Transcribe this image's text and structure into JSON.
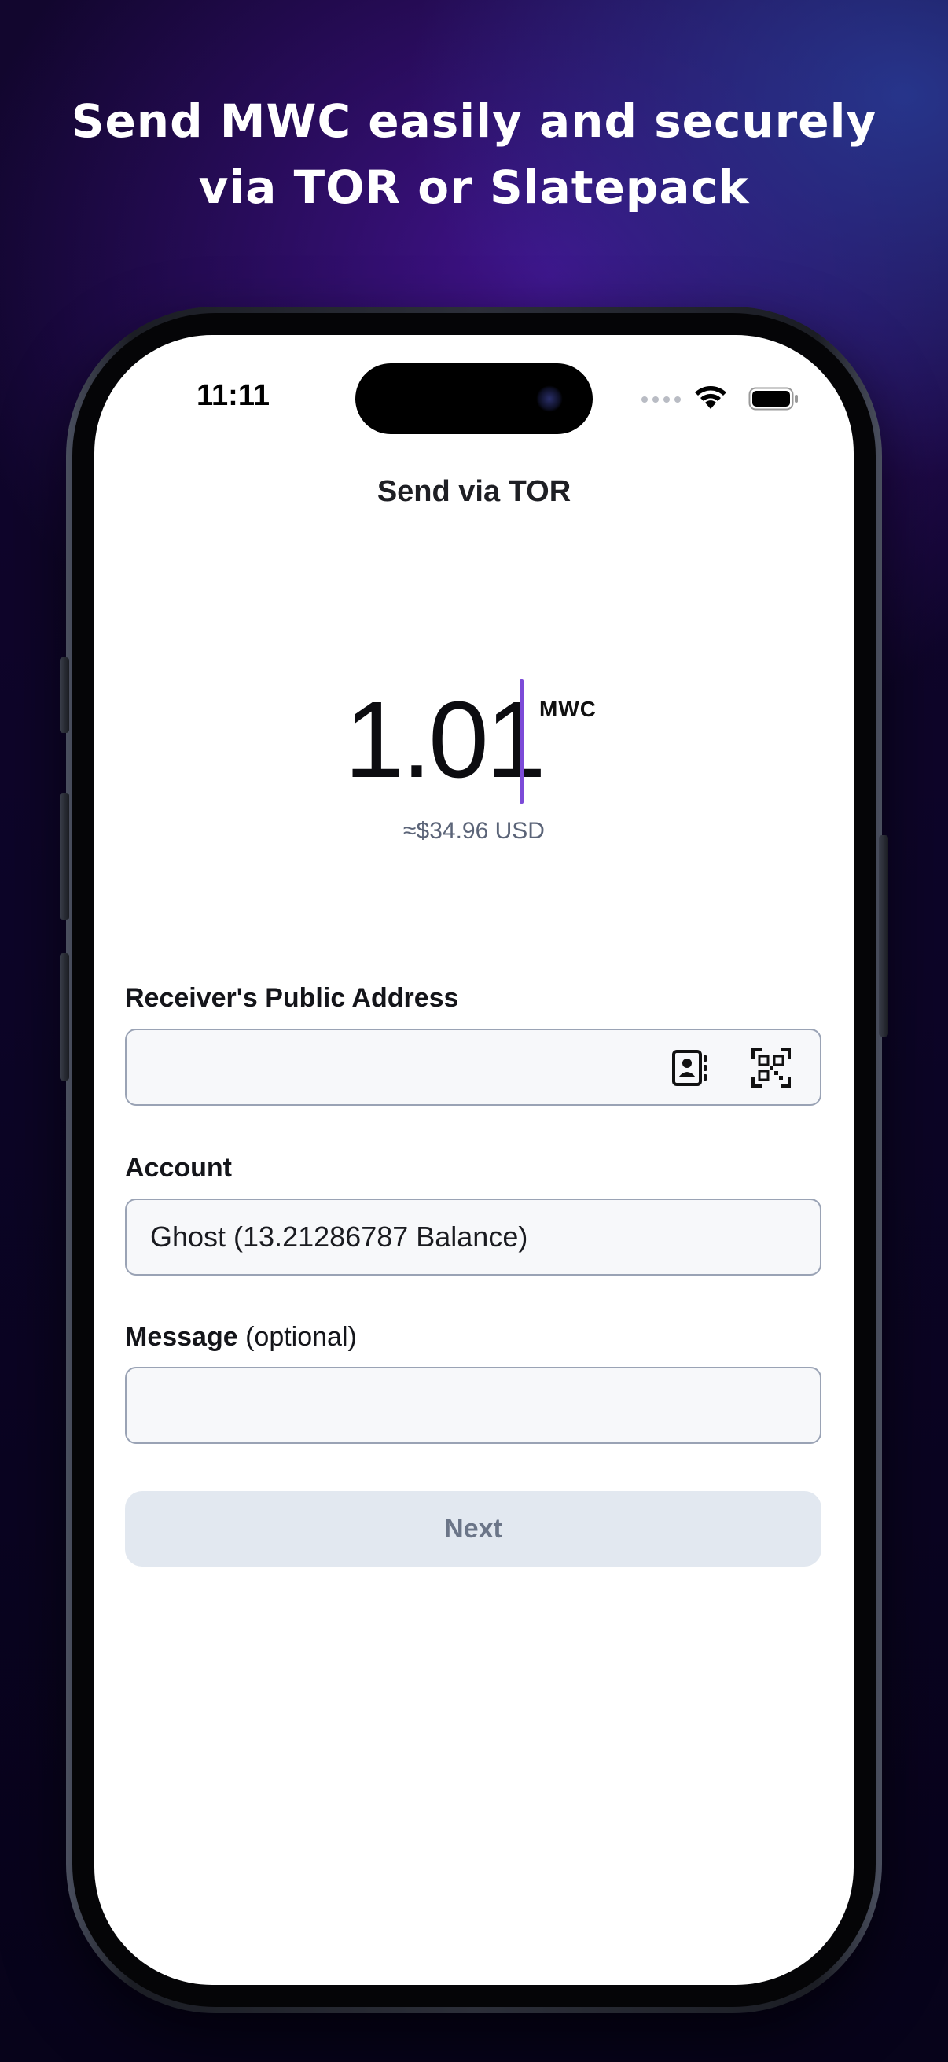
{
  "headline": {
    "line1": "Send MWC easily and securely",
    "line2": "via TOR or Slatepack"
  },
  "status_bar": {
    "time": "11:11",
    "icons": [
      "cellular-dots-icon",
      "wifi-icon",
      "battery-icon"
    ]
  },
  "nav": {
    "title": "Send via TOR"
  },
  "amount": {
    "value": "1.01",
    "unit": "MWC",
    "fiat": "≈$34.96 USD"
  },
  "form": {
    "receiver_label": "Receiver's Public Address",
    "receiver_value": "",
    "receiver_icons": [
      "contacts-icon",
      "qr-scan-icon"
    ],
    "account_label": "Account",
    "account_value": "Ghost (13.21286787 Balance)",
    "message_label": "Message",
    "message_optional": "(optional)",
    "message_value": ""
  },
  "next_button": {
    "label": "Next"
  },
  "colors": {
    "accent_caret": "#7c4bd8",
    "button_bg": "#e2e8f0",
    "button_text": "#6b7588",
    "field_border": "#9aa3b5"
  }
}
